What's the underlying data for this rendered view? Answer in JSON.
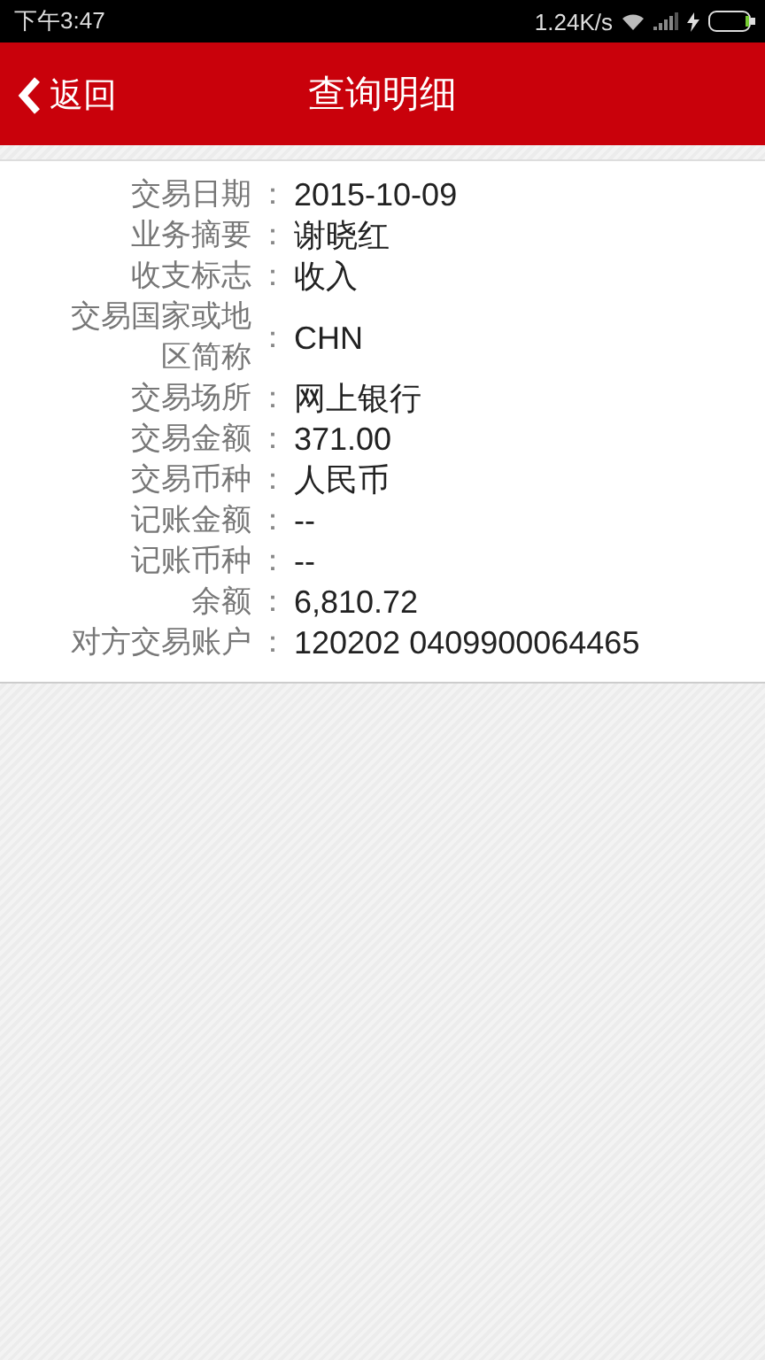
{
  "status_bar": {
    "time": "下午3:47",
    "speed": "1.24K/s"
  },
  "header": {
    "back": "返回",
    "title": "查询明细"
  },
  "details": [
    {
      "label": "交易日期",
      "colon": "：",
      "value": "2015-10-09"
    },
    {
      "label": "业务摘要",
      "colon": "：",
      "value": "谢晓红"
    },
    {
      "label": "收支标志",
      "colon": "：",
      "value": "收入"
    },
    {
      "label": "交易国家或地区简称",
      "colon": "：",
      "value": "CHN"
    },
    {
      "label": "交易场所",
      "colon": "：",
      "value": "网上银行"
    },
    {
      "label": "交易金额",
      "colon": "：",
      "value": "371.00"
    },
    {
      "label": "交易币种",
      "colon": "：",
      "value": "人民币"
    },
    {
      "label": "记账金额",
      "colon": "：",
      "value": "--"
    },
    {
      "label": "记账币种",
      "colon": "：",
      "value": "--"
    },
    {
      "label": "余额",
      "colon": "：",
      "value": "6,810.72"
    },
    {
      "label": "对方交易账户",
      "colon": "：",
      "value": "120202 0409900064465"
    }
  ]
}
